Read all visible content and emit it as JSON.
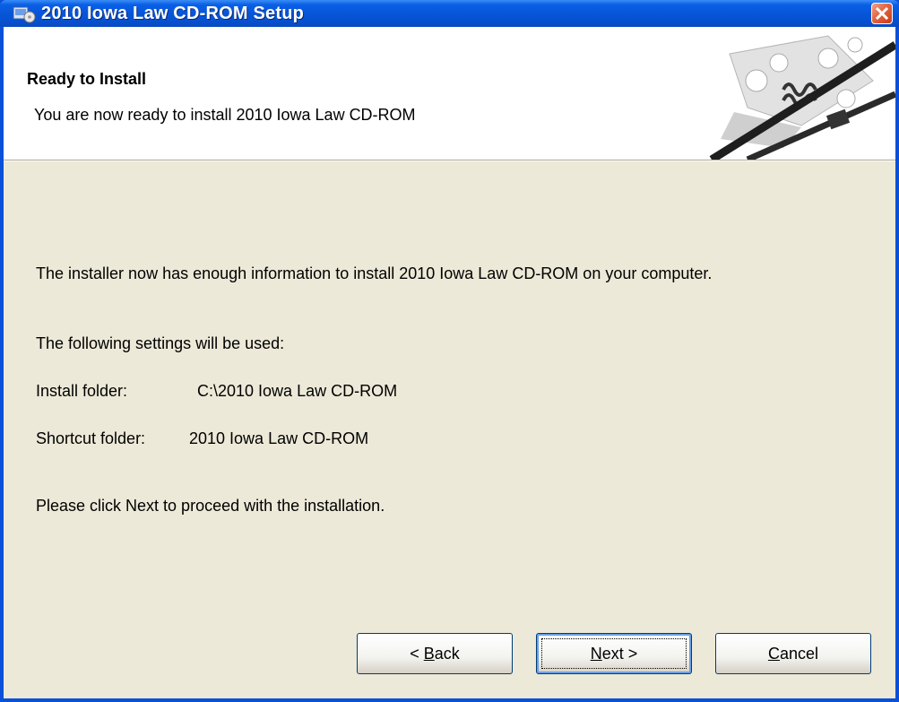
{
  "window": {
    "title": "2010 Iowa Law CD-ROM Setup"
  },
  "header": {
    "title": "Ready to Install",
    "subtitle": "You are now ready to install 2010 Iowa Law CD-ROM"
  },
  "body": {
    "intro": "The installer now has enough information to install 2010 Iowa Law CD-ROM on your computer.",
    "settings_heading": "The following settings will be used:",
    "install_folder_label": "Install folder:",
    "install_folder_value": "C:\\2010 Iowa Law CD-ROM",
    "shortcut_folder_label": "Shortcut folder:",
    "shortcut_folder_value": "2010 Iowa Law CD-ROM",
    "instruction": "Please click Next to proceed with the installation."
  },
  "buttons": {
    "back": {
      "prefix": "< ",
      "mnemonic": "B",
      "rest": "ack"
    },
    "next": {
      "mnemonic": "N",
      "rest": "ext >"
    },
    "cancel": {
      "mnemonic": "C",
      "rest": "ancel"
    }
  },
  "icons": {
    "app": "setup-icon",
    "close": "close-icon",
    "header_graphic": "gears-graphic"
  }
}
